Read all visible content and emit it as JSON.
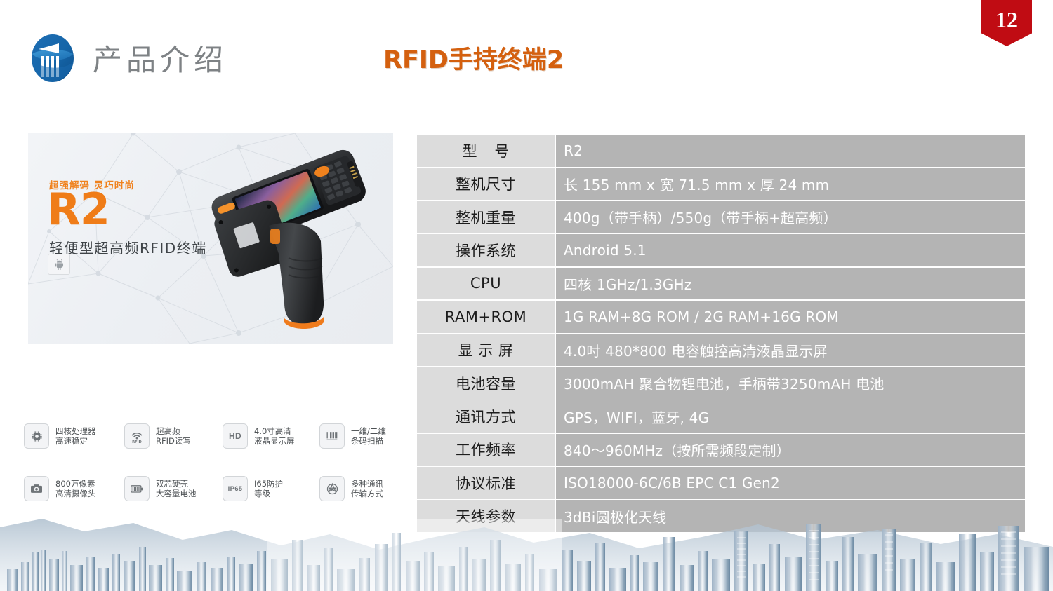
{
  "header": {
    "logo_name": "company-logo",
    "section_title": "产品介绍",
    "slide_title": "RFID手持终端2",
    "page_number": "12",
    "accent_orange": "#d4600f",
    "badge_red": "#c00c13",
    "section_title_gray": "#7e8285"
  },
  "product_banner": {
    "kicker": "超强解码 灵巧时尚",
    "model": "R2",
    "subtitle": "轻便型超高频RFID终端",
    "os_icon": "android-icon",
    "device_image_alt": "RFID手持终端 R2",
    "model_orange": "#ef7c18"
  },
  "features": [
    {
      "icon": "cpu-icon",
      "badge": "",
      "line1": "四核处理器",
      "line2": "高速稳定"
    },
    {
      "icon": "rfid-icon",
      "badge": "RFID",
      "line1": "超高频",
      "line2": "RFID读写"
    },
    {
      "icon": "hd-icon",
      "badge": "HD",
      "line1": "4.0寸高清",
      "line2": "液晶显示屏"
    },
    {
      "icon": "barcode-icon",
      "badge": "",
      "line1": "一维/二维",
      "line2": "条码扫描"
    },
    {
      "icon": "camera-icon",
      "badge": "",
      "line1": "800万像素",
      "line2": "高清摄像头"
    },
    {
      "icon": "battery-icon",
      "badge": "",
      "line1": "双芯硬壳",
      "line2": "大容量电池"
    },
    {
      "icon": "ip65-icon",
      "badge": "IP65",
      "line1": "I65防护",
      "line2": "等级"
    },
    {
      "icon": "network-icon",
      "badge": "",
      "line1": "多种通讯",
      "line2": "传输方式"
    }
  ],
  "spec_table": {
    "label_bg": "#dcdcdc",
    "value_bg": "#b4b4b4",
    "rows": [
      {
        "label": "型    号",
        "value": "R2",
        "spaced": true
      },
      {
        "label": "整机尺寸",
        "value": "长 155 mm x 宽 71.5 mm x 厚 24 mm",
        "spaced": false
      },
      {
        "label": "整机重量",
        "value": "400g（带手柄）/550g（带手柄+超高频）",
        "spaced": false
      },
      {
        "label": "操作系统",
        "value": "Android 5.1",
        "spaced": false
      },
      {
        "label": "CPU",
        "value": "四核 1GHz/1.3GHz",
        "spaced": false
      },
      {
        "label": "RAM+ROM",
        "value": "1G RAM+8G ROM / 2G RAM+16G ROM",
        "spaced": false
      },
      {
        "label": "显 示 屏",
        "value": "4.0吋 480*800 电容触控高清液晶显示屏",
        "spaced": false
      },
      {
        "label": "电池容量",
        "value": "3000mAH 聚合物锂电池，手柄带3250mAH 电池",
        "spaced": false
      },
      {
        "label": "通讯方式",
        "value": "GPS，WIFI，蓝牙, 4G",
        "spaced": false
      },
      {
        "label": "工作频率",
        "value": "840～960MHz（按所需频段定制）",
        "spaced": false
      },
      {
        "label": "协议标准",
        "value": "ISO18000-6C/6B EPC C1 Gen2",
        "spaced": false
      },
      {
        "label": "天线参数",
        "value": "3dBi圆极化天线",
        "spaced": false
      }
    ]
  },
  "footer": {
    "image_name": "cityscape-skyline",
    "tint": "#8fa6bc"
  }
}
